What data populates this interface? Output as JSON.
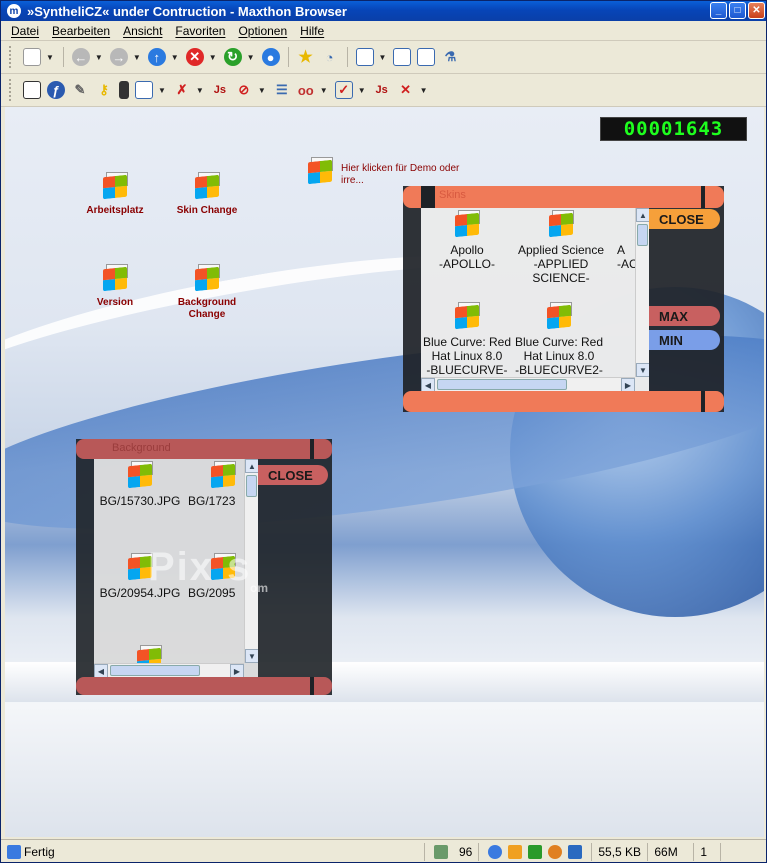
{
  "window": {
    "title": "»SyntheliCZ« under Contruction - Maxthon Browser",
    "app_icon": "maxthon-m-icon"
  },
  "menu": [
    "Datei",
    "Bearbeiten",
    "Ansicht",
    "Favoriten",
    "Optionen",
    "Hilfe"
  ],
  "counter": "00001643",
  "desktop_icons": [
    {
      "label": "Arbeitsplatz"
    },
    {
      "label": "Skin Change"
    },
    {
      "label": "Version"
    },
    {
      "label": "Background Change"
    }
  ],
  "demo_link": "Hier klicken für Demo oder irre...",
  "skins_panel": {
    "title": "Skins",
    "close": "CLOSE",
    "max": "MAX",
    "min": "MIN",
    "items": [
      {
        "name": "Apollo",
        "code": "-APOLLO-"
      },
      {
        "name": "Applied Science",
        "code": "-APPLIED SCIENCE-"
      },
      {
        "name": "A",
        "code": "-AC"
      },
      {
        "name": "Blue Curve: Red Hat Linux 8.0",
        "code": "-BLUECURVE-"
      },
      {
        "name": "Blue Curve: Red Hat Linux 8.0",
        "code": "-BLUECURVE2-"
      }
    ]
  },
  "bg_panel": {
    "title": "Background",
    "close": "CLOSE",
    "items": [
      "BG/15730.JPG",
      "BG/1723",
      "BG/20954.JPG",
      "BG/2095"
    ]
  },
  "watermark": "Pix  s",
  "watermark_sub": "om",
  "status": {
    "text": "Fertig",
    "popups": "96",
    "size": "55,5 KB",
    "memory": "66M",
    "tabs": "1"
  },
  "colors": {
    "title_blue": "#0745b8",
    "panel_orange": "#f07a58",
    "panel_red": "#b85858",
    "counter_green": "#1eff1e",
    "label_red": "#8a0000"
  }
}
